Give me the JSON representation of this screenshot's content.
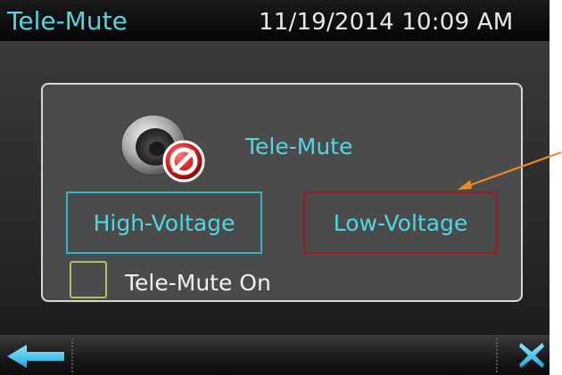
{
  "window": {
    "title": "Tele-Mute",
    "datetime": "11/19/2014 10:09 AM"
  },
  "panel": {
    "title": "Tele-Mute",
    "icon": "speaker-muted-icon",
    "buttons": {
      "high_voltage": "High-Voltage",
      "low_voltage": "Low-Voltage"
    },
    "checkbox": {
      "label": "Tele-Mute On",
      "checked": false
    }
  },
  "navigation": {
    "back_icon": "back-arrow-icon",
    "close_icon": "close-icon"
  },
  "colors": {
    "accent_cyan": "#4fd7e3",
    "high_voltage_border": "#2fb7c6",
    "low_voltage_border": "#9b1d1d",
    "checkbox_border": "#a9c462",
    "annotation_arrow": "#f28a1f",
    "panel_background": "#4b4b4b"
  }
}
